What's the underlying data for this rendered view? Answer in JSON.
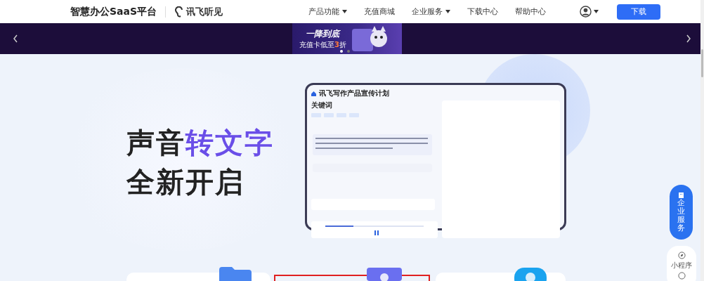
{
  "header": {
    "brand": "智慧办公SaaS平台",
    "logo_text": "讯飞听见",
    "nav": [
      {
        "label": "产品功能",
        "has_menu": true
      },
      {
        "label": "充值商城",
        "has_menu": false
      },
      {
        "label": "企业服务",
        "has_menu": true
      },
      {
        "label": "下载中心",
        "has_menu": false
      },
      {
        "label": "帮助中心",
        "has_menu": false
      }
    ],
    "download_button": "下载"
  },
  "banner": {
    "headline": "一降到底",
    "subline_before": "充值卡低至",
    "subline_highlight": "3",
    "subline_after": "折",
    "dots": [
      {
        "selected": true
      },
      {
        "selected": false
      }
    ]
  },
  "hero": {
    "title_plain": "声音",
    "title_highlight": "转文字",
    "title_line_2": "全新开启"
  },
  "mockup": {
    "doc_title": "讯飞写作产品宣传计划",
    "keywords_label": "关键词"
  },
  "side": {
    "enterprise_button": "企业服务",
    "mini_program": "小程序"
  }
}
